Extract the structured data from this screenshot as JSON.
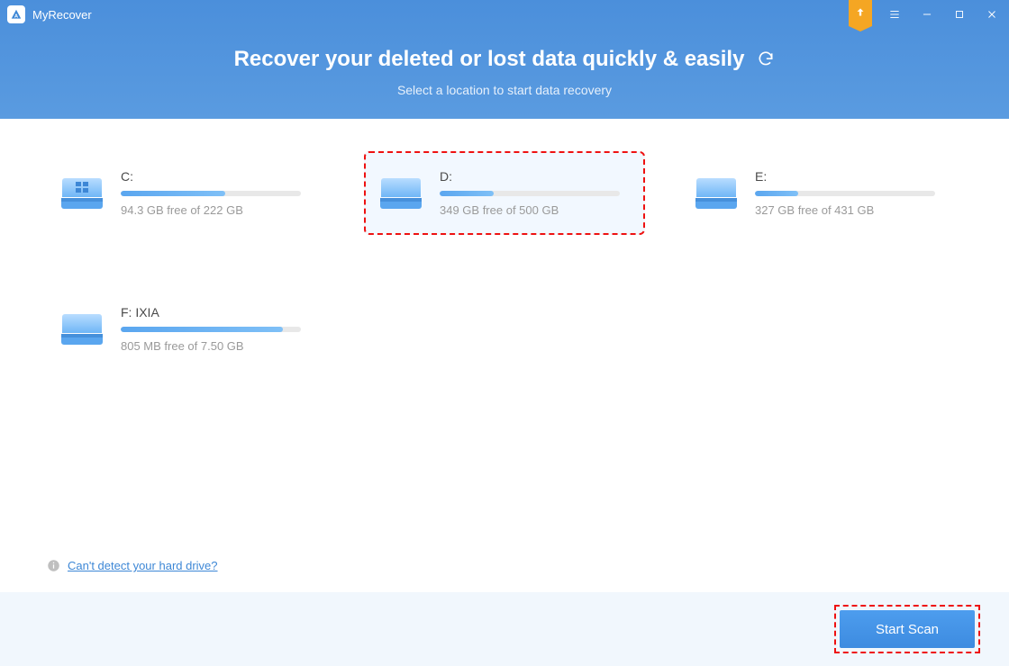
{
  "app": {
    "title": "MyRecover"
  },
  "hero": {
    "title": "Recover your deleted or lost data quickly & easily",
    "subtitle": "Select a location to start data recovery"
  },
  "drives": [
    {
      "label": "C:",
      "free_text": "94.3 GB free of 222 GB",
      "used_pct": 58,
      "selected": false,
      "windows": true
    },
    {
      "label": "D:",
      "free_text": "349 GB free of 500 GB",
      "used_pct": 30,
      "selected": true,
      "windows": false
    },
    {
      "label": "E:",
      "free_text": "327 GB free of 431 GB",
      "used_pct": 24,
      "selected": false,
      "windows": false
    },
    {
      "label": "F: IXIA",
      "free_text": "805 MB free of 7.50 GB",
      "used_pct": 90,
      "selected": false,
      "windows": false
    }
  ],
  "detect_link": "Can't detect your hard drive?  ",
  "footer": {
    "start_label": "Start Scan"
  }
}
